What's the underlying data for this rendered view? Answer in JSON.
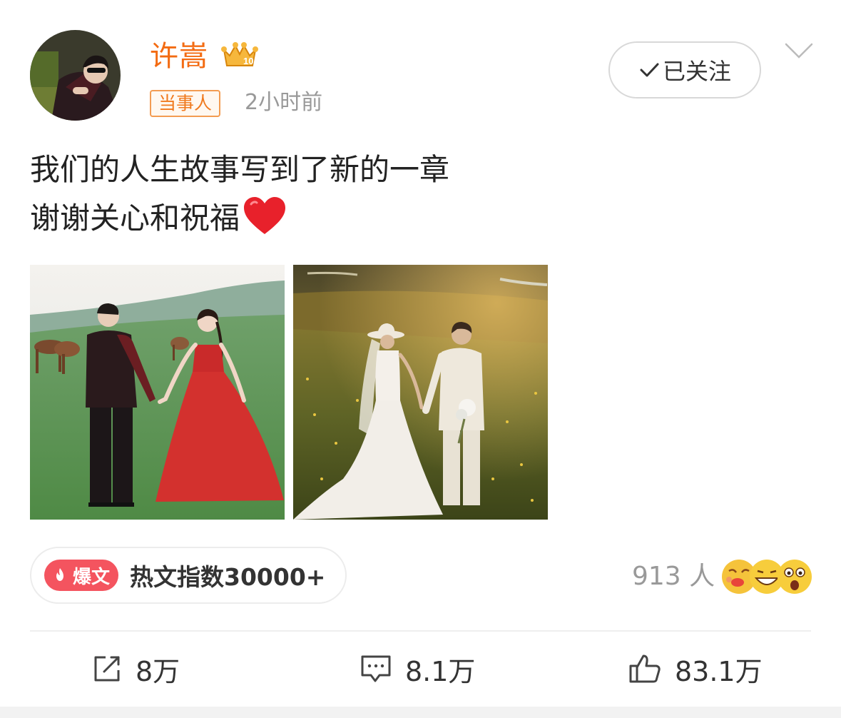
{
  "post": {
    "author": {
      "name": "许嵩",
      "tag": "当事人",
      "time": "2小时前",
      "avatar_icon": "avatar-photo",
      "vip_icon": "vip-crown-badge-icon"
    },
    "follow": {
      "label": "已关注",
      "check_icon": "checkmark-icon"
    },
    "more_icon": "chevron-down-icon",
    "content": {
      "lines": [
        "我们的人生故事写到了新的一章",
        "谢谢关心和祝福"
      ],
      "emoji": "red-heart-emoji"
    },
    "images": [
      {
        "name": "wedding-photo-red-dress"
      },
      {
        "name": "wedding-photo-sunset"
      }
    ],
    "hot": {
      "badge_label": "爆文",
      "text": "热文指数30000+"
    },
    "reactions": {
      "count_text": "913 人",
      "emojis": [
        "kiss-emoji",
        "grin-emoji",
        "surprised-emoji"
      ]
    },
    "actions": {
      "share": {
        "count": "8万",
        "icon": "share-icon"
      },
      "comment": {
        "count": "8.1万",
        "icon": "comment-icon"
      },
      "like": {
        "count": "83.1万",
        "icon": "thumbs-up-icon"
      }
    },
    "colors": {
      "username": "#f36b12",
      "hot_badge": "#f4545f",
      "tag_border": "#f39c52"
    }
  }
}
